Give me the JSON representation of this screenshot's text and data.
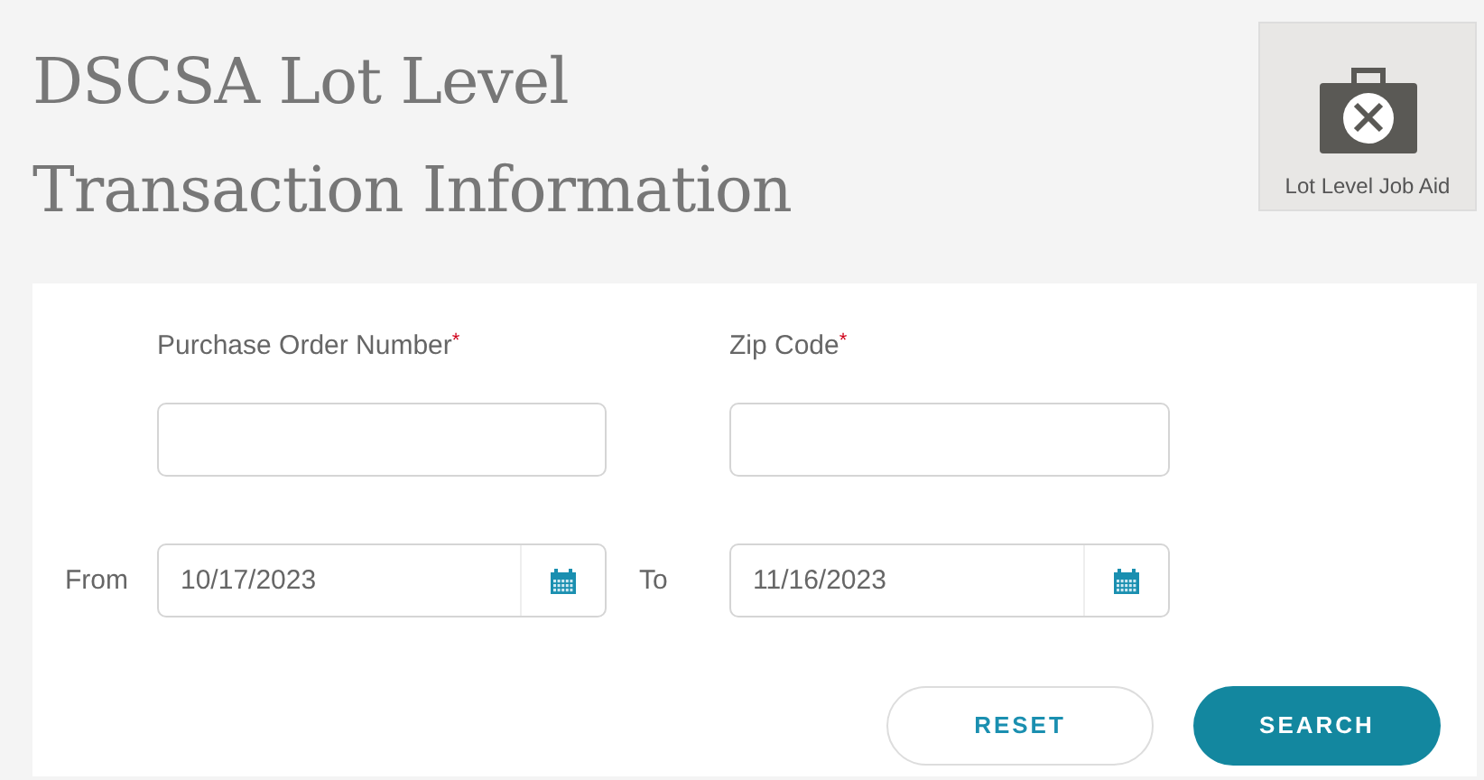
{
  "title_lines": [
    "DSCSA Lot Level",
    "Transaction Information"
  ],
  "job_aid": {
    "label": "Lot Level Job Aid"
  },
  "text_fields": [
    {
      "label": "Purchase Order Number",
      "required_mark": "*"
    },
    {
      "label": "Zip Code",
      "required_mark": "*"
    }
  ],
  "date_fields": [
    {
      "label": "From",
      "value": "10/17/2023"
    },
    {
      "label": "To",
      "value": "11/16/2023"
    }
  ],
  "buttons": [
    {
      "label": "RESET",
      "kind": "secondary"
    },
    {
      "label": "SEARCH",
      "kind": "primary"
    }
  ]
}
